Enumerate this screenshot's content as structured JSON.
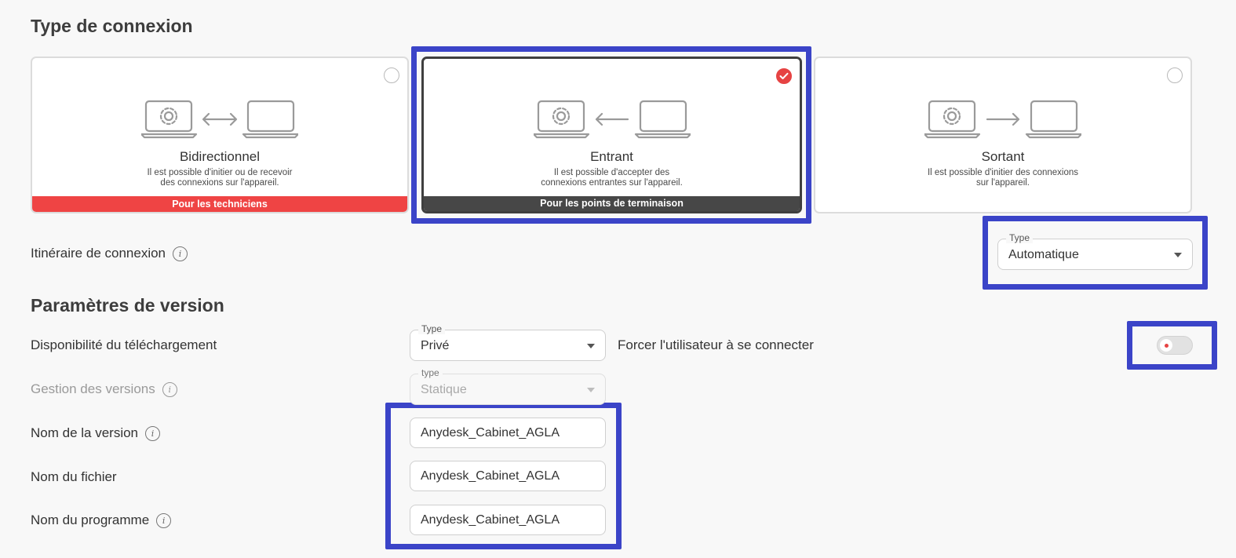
{
  "connection_type": {
    "title": "Type de connexion",
    "cards": [
      {
        "title": "Bidirectionnel",
        "desc_line1": "Il est possible d'initier ou de recevoir",
        "desc_line2": "des connexions sur l'appareil.",
        "band": "Pour les techniciens",
        "band_color": "#ef4444",
        "selected": false,
        "arrow": "bidirectional-arrow"
      },
      {
        "title": "Entrant",
        "desc_line1": "Il est possible d'accepter des",
        "desc_line2": "connexions entrantes sur l'appareil.",
        "band": "Pour les points de terminaison",
        "band_color": "#474747",
        "selected": true,
        "arrow": "arrow-left"
      },
      {
        "title": "Sortant",
        "desc_line1": "Il est possible d'initier des connexions",
        "desc_line2": "sur l'appareil.",
        "band": "",
        "selected": false,
        "arrow": "arrow-right"
      }
    ]
  },
  "route": {
    "label": "Itinéraire de connexion",
    "select_legend": "Type",
    "select_value": "Automatique"
  },
  "version_settings": {
    "title": "Paramètres de version",
    "download_label": "Disponibilité du téléchargement",
    "download_legend": "Type",
    "download_value": "Privé",
    "force_login_label": "Forcer l'utilisateur à se connecter",
    "force_login_enabled": false,
    "version_mgmt_label": "Gestion des versions",
    "version_mgmt_legend": "type",
    "version_mgmt_value": "Statique",
    "version_name_label": "Nom de la version",
    "version_name_value": "Anydesk_Cabinet_AGLA",
    "file_name_label": "Nom du fichier",
    "file_name_value": "Anydesk_Cabinet_AGLA",
    "program_name_label": "Nom du programme",
    "program_name_value": "Anydesk_Cabinet_AGLA"
  },
  "colors": {
    "highlight": "#3b44c8",
    "accent_red": "#e64343"
  },
  "icons": {
    "info": "i",
    "check": "check-icon"
  }
}
